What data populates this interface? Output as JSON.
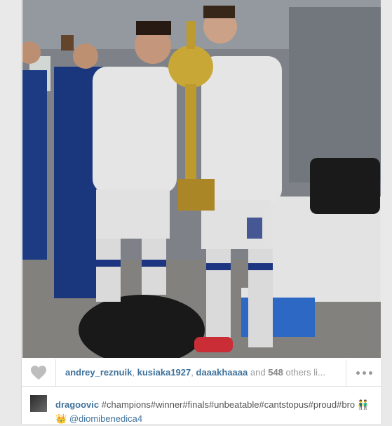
{
  "post": {
    "photo_alt": "",
    "likes": {
      "users": [
        "andrey_reznuik",
        "kusiaka1927",
        "daaakhaaaa"
      ],
      "separator": ",",
      "and_text": "and",
      "count": "548",
      "others_text": "others li..."
    },
    "caption": {
      "username": "dragoovic",
      "text": "#champions#winner#finals#unbeatable#cantstopus#proud#bro",
      "emoji": "👬👑",
      "mention": "@diomibenedica4"
    }
  },
  "colors": {
    "link": "#3f729b",
    "muted": "#999999"
  },
  "icons": {
    "like": "heart-icon",
    "more": "more-dots-icon"
  }
}
